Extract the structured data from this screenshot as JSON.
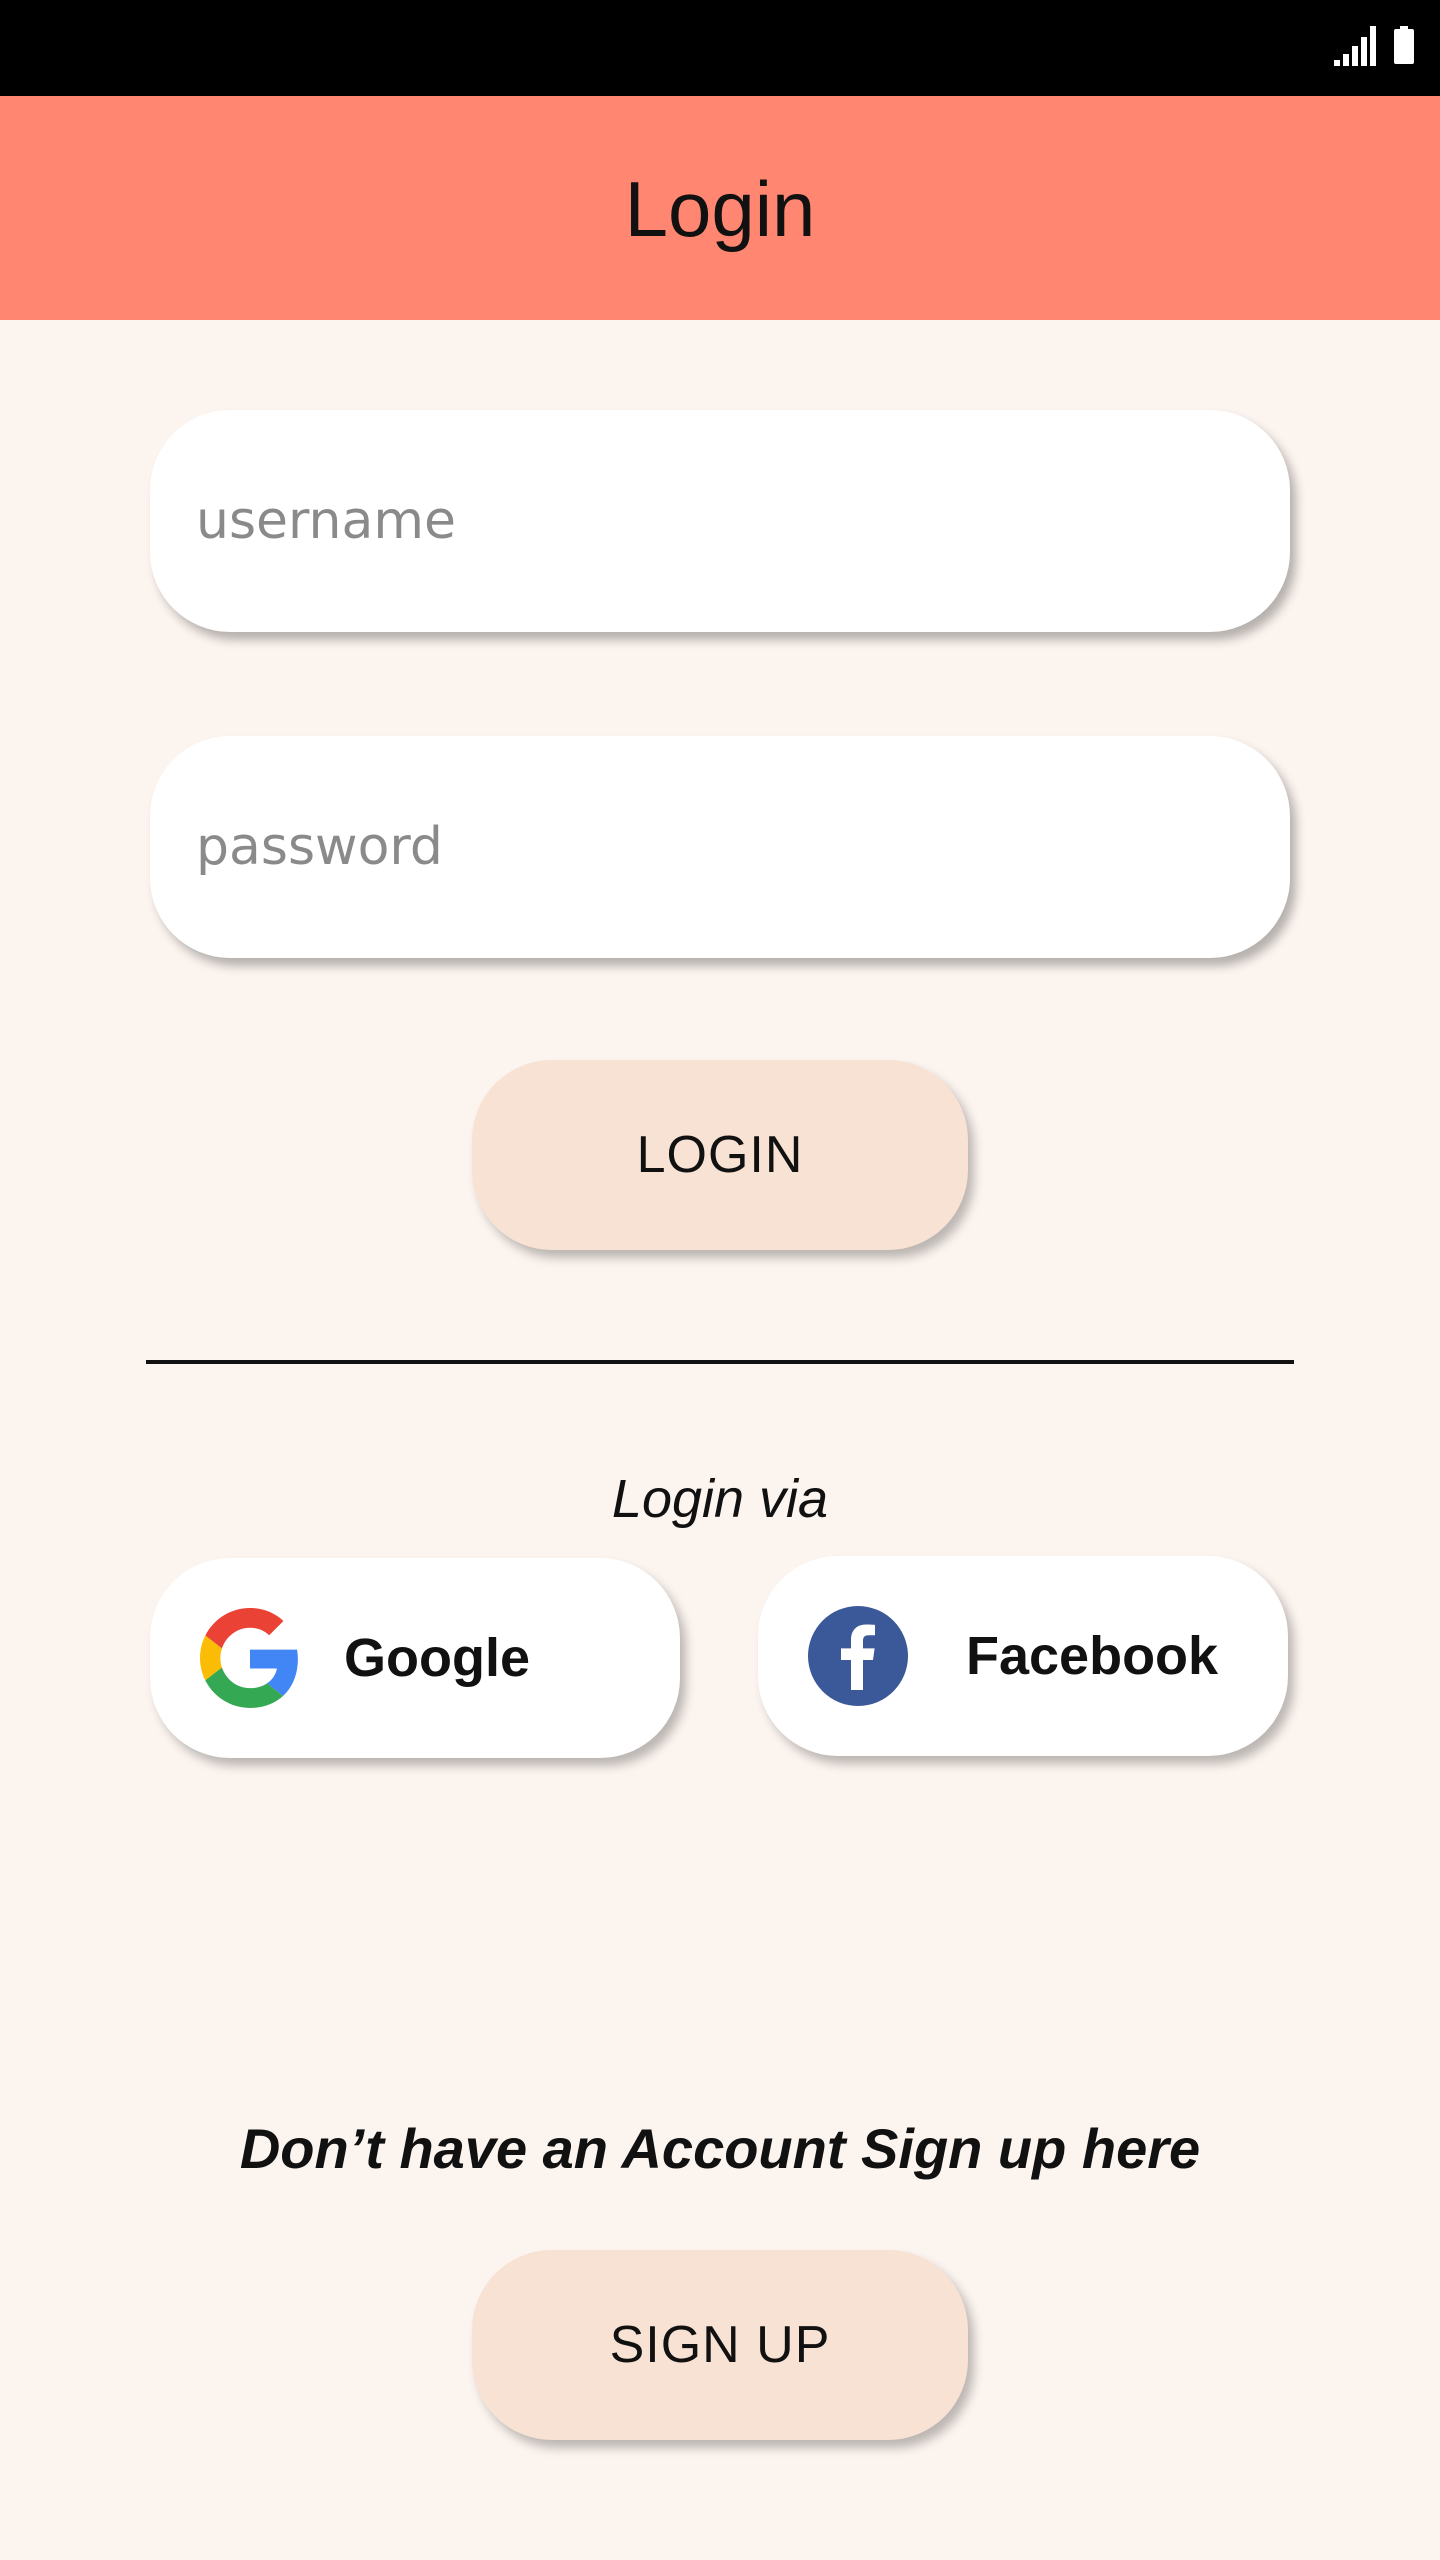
{
  "app_bar": {
    "title": "Login"
  },
  "form": {
    "username_placeholder": "username",
    "password_placeholder": "password",
    "login_label": "LOGIN"
  },
  "social": {
    "heading": "Login via",
    "google_label": "Google",
    "facebook_label": "Facebook"
  },
  "signup": {
    "prompt": "Don’t have an Account Sign up here",
    "button_label": "SIGN UP"
  },
  "icons": {
    "signal": "signal-icon",
    "battery": "battery-icon",
    "google": "google-logo-icon",
    "facebook": "facebook-logo-icon"
  },
  "colors": {
    "app_bar": "#ff8670",
    "background": "#fcf4ef",
    "button": "#f8e2d4",
    "facebook_blue": "#3b5998"
  }
}
